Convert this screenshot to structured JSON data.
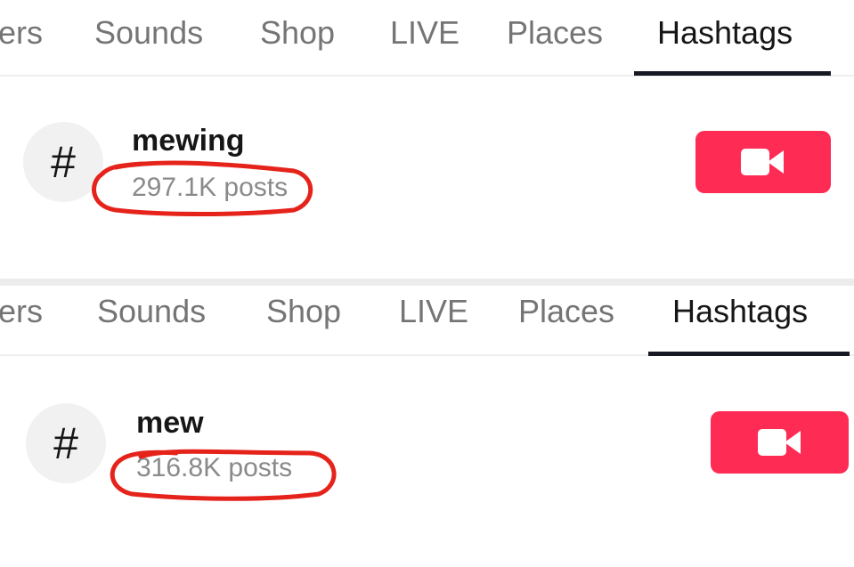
{
  "colors": {
    "accent": "#fe2c55",
    "active_tab": "#161616",
    "inactive_tab": "#757575",
    "annotation": "#e5231b"
  },
  "panels": [
    {
      "tabs": [
        {
          "label": "ers",
          "active": false
        },
        {
          "label": "Sounds",
          "active": false
        },
        {
          "label": "Shop",
          "active": false
        },
        {
          "label": "LIVE",
          "active": false
        },
        {
          "label": "Places",
          "active": false
        },
        {
          "label": "Hashtags",
          "active": true
        }
      ],
      "result": {
        "icon": "hashtag-icon",
        "icon_glyph": "#",
        "name": "mewing",
        "count": "297.1K posts",
        "action_icon": "video-camera-icon"
      }
    },
    {
      "tabs": [
        {
          "label": "ers",
          "active": false
        },
        {
          "label": "Sounds",
          "active": false
        },
        {
          "label": "Shop",
          "active": false
        },
        {
          "label": "LIVE",
          "active": false
        },
        {
          "label": "Places",
          "active": false
        },
        {
          "label": "Hashtags",
          "active": true
        }
      ],
      "result": {
        "icon": "hashtag-icon",
        "icon_glyph": "#",
        "name": "mew",
        "count": "316.8K posts",
        "action_icon": "video-camera-icon"
      }
    }
  ]
}
